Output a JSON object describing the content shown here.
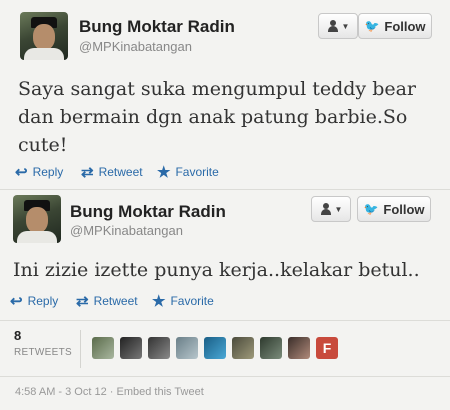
{
  "tweets": [
    {
      "display_name": "Bung Moktar Radin",
      "handle": "@MPKinabatangan",
      "follow_label": "Follow",
      "text": "Saya sangat suka mengumpul teddy bear dan bermain dgn anak patung barbie.So cute!",
      "actions": {
        "reply": "Reply",
        "retweet": "Retweet",
        "favorite": "Favorite"
      }
    },
    {
      "display_name": "Bung Moktar Radin",
      "handle": "@MPKinabatangan",
      "follow_label": "Follow",
      "text": "Ini zizie izette punya kerja..kelakar betul..",
      "actions": {
        "reply": "Reply",
        "retweet": "Retweet",
        "favorite": "Favorite"
      }
    }
  ],
  "stats": {
    "retweet_count": "8",
    "retweet_label": "RETWEETS"
  },
  "retweeter_avatars": [
    {
      "icon": "user-avatar"
    },
    {
      "icon": "user-avatar"
    },
    {
      "icon": "user-avatar"
    },
    {
      "icon": "user-avatar"
    },
    {
      "icon": "user-avatar"
    },
    {
      "icon": "user-avatar"
    },
    {
      "icon": "user-avatar"
    },
    {
      "icon": "user-avatar"
    },
    {
      "icon": "user-avatar",
      "letter": "F"
    }
  ],
  "meta": {
    "timestamp": "4:58 AM - 3 Oct 12",
    "separator": "·",
    "embed": "Embed this Tweet"
  },
  "colors": {
    "link": "#2a6aa8",
    "twitter_bird": "#2aa9e0",
    "background": "#f3f3f1"
  }
}
